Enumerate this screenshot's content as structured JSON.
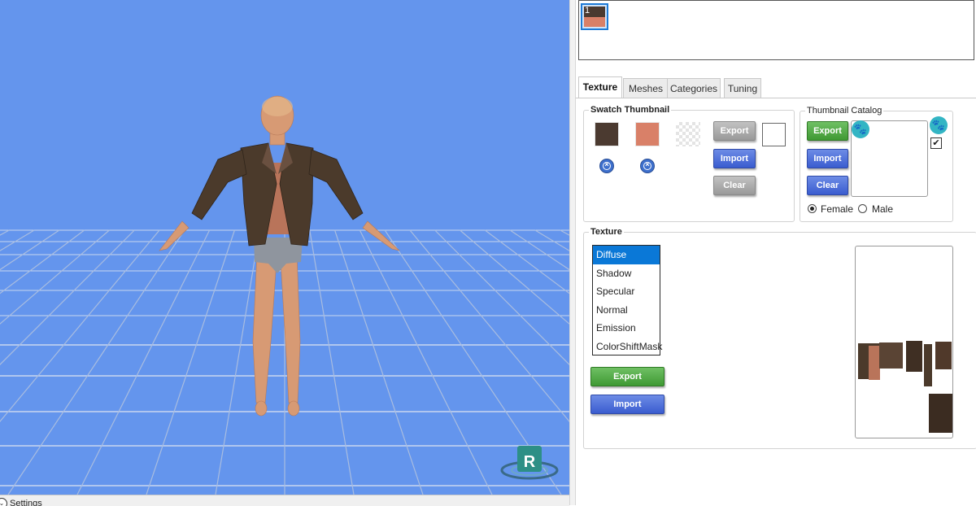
{
  "viewport": {
    "background": "#6495ed",
    "settings_label": "Settings",
    "gizmo_letter": "R"
  },
  "swatches": {
    "items": [
      {
        "number": "1",
        "top_color": "#4b3a30",
        "bottom_color": "#d98068"
      }
    ]
  },
  "tabs": [
    {
      "label": "Texture",
      "active": true
    },
    {
      "label": "Meshes",
      "active": false
    },
    {
      "label": "Categories",
      "active": false
    },
    {
      "label": "Tuning",
      "active": false
    }
  ],
  "swatch_thumbnail": {
    "title": "Swatch Thumbnail",
    "color_1": "#4b3a30",
    "color_2": "#d98068",
    "export_label": "Export",
    "import_label": "Import",
    "clear_label": "Clear"
  },
  "thumbnail_catalog": {
    "title": "Thumbnail Catalog",
    "export_label": "Export",
    "import_label": "Import",
    "clear_label": "Clear",
    "checkbox_checked": true,
    "gender_options": [
      "Female",
      "Male"
    ],
    "selected_gender": "Female"
  },
  "texture": {
    "title": "Texture",
    "list": [
      "Diffuse",
      "Shadow",
      "Specular",
      "Normal",
      "Emission",
      "ColorShiftMask"
    ],
    "selected": "Diffuse",
    "export_label": "Export",
    "import_label": "Import"
  }
}
